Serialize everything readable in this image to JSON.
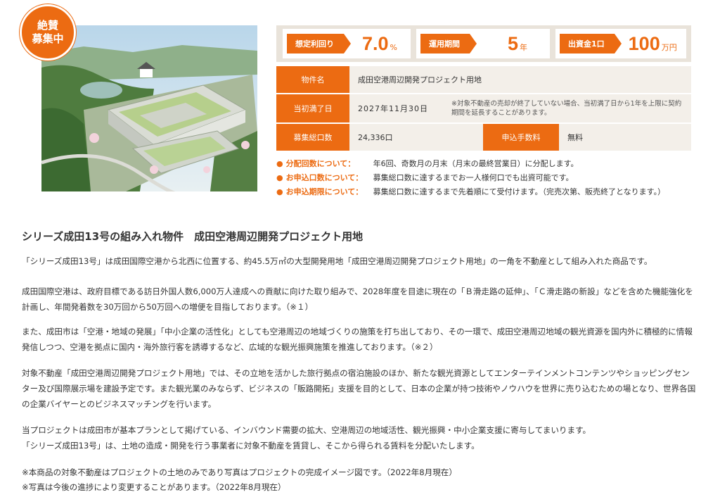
{
  "badge": {
    "line1": "絶賛",
    "line2": "募集中"
  },
  "stats": [
    {
      "label": "想定利回り",
      "value": "7.0",
      "unit": "%"
    },
    {
      "label": "運用期間",
      "value": "5",
      "unit": "年"
    },
    {
      "label": "出資金1口",
      "value": "100",
      "unit": "万円"
    }
  ],
  "table": {
    "property_label": "物件名",
    "property_value": "成田空港周辺開発プロジェクト用地",
    "maturity_label": "当初満了日",
    "maturity_value": "2027年11月30日",
    "maturity_note": "※対象不動産の売却が終了していない場合、当初満了日から1年を上限に契約期間を延長することがあります。",
    "units_label": "募集総口数",
    "units_value": "24,336口",
    "fee_label": "申込手数料",
    "fee_value": "無料"
  },
  "bullets": [
    {
      "label": "分配回数について：",
      "text": "年6回、奇数月の月末（月末の最終営業日）に分配します。"
    },
    {
      "label": "お申込口数について：",
      "text": "募集総口数に達するまでお一人様何口でも出資可能です。"
    },
    {
      "label": "お申込期限について：",
      "text": "募集総口数に達するまで先着順にて受付けます。（完売次第、販売終了となります。）"
    }
  ],
  "section_title": "シリーズ成田13号の組み入れ物件　成田空港周辺開発プロジェクト用地",
  "paragraphs": {
    "p1": "「シリーズ成田13号」は成田国際空港から北西に位置する、約45.5万㎡の大型開発用地「成田空港周辺開発プロジェクト用地」の一角を不動産として組み入れた商品です。",
    "p2": "成田国際空港は、政府目標である訪日外国人数6,000万人達成への貢献に向けた取り組みで、2028年度を目途に現在の「Ｂ滑走路の延伸」、「Ｃ滑走路の新設」などを含めた機能強化を計画し、年間発着数を30万回から50万回への増便を目指しております。（※１）",
    "p3": "また、成田市は「空港・地域の発展」「中小企業の活性化」としても空港周辺の地域づくりの施策を打ち出しており、その一環で、成田空港周辺地域の観光資源を国内外に積極的に情報発信しつつ、空港を拠点に国内・海外旅行客を誘導するなど、広域的な観光振興施策を推進しております。（※２）",
    "p4": "対象不動産「成田空港周辺開発プロジェクト用地」では、その立地を活かした旅行拠点の宿泊施設のほか、新たな観光資源としてエンターテインメントコンテンツやショッピングセンター及び国際展示場を建設予定です。また観光業のみならず、ビジネスの「販路開拓」支援を目的として、日本の企業が持つ技術やノウハウを世界に売り込むための場となり、世界各国の企業バイヤーとのビジネスマッチングを行います。",
    "p5a": "当プロジェクトは成田市が基本プランとして掲げている、インバウンド需要の拡大、空港周辺の地域活性、観光振興・中小企業支援に寄与してまいります。",
    "p5b": "「シリーズ成田13号」は、土地の造成・開発を行う事業者に対象不動産を賃貸し、そこから得られる賃料を分配いたします。",
    "n1": "※本商品の対象不動産はプロジェクトの土地のみであり写真はプロジェクトの完成イメージ図です。（2022年8月現在）",
    "n2": "※写真は今後の進捗により変更することがあります。（2022年8月現在）"
  },
  "colors": {
    "accent": "#ec6b12",
    "panel": "#e9e3da",
    "cell": "#f3efe9"
  }
}
